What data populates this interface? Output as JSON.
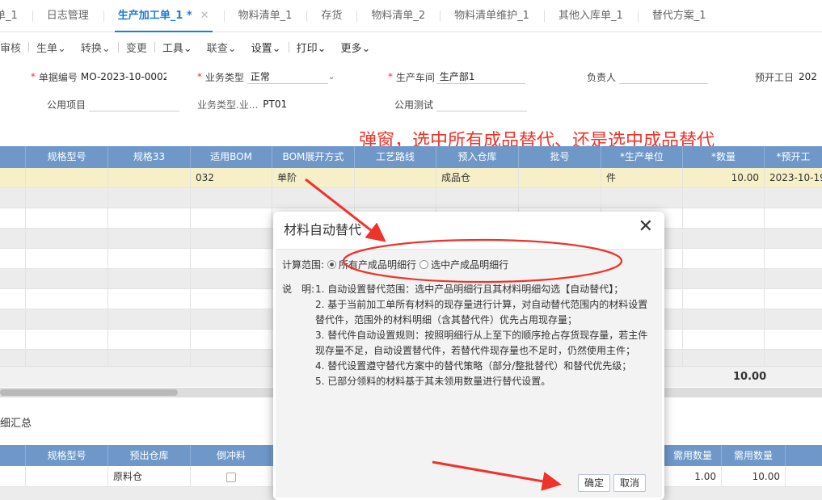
{
  "tabs": [
    {
      "label": "单_1"
    },
    {
      "label": "日志管理"
    },
    {
      "label": "生产加工单_1 *",
      "active": true
    },
    {
      "label": "物料清单_1"
    },
    {
      "label": "存货"
    },
    {
      "label": "物料清单_2"
    },
    {
      "label": "物料清单维护_1"
    },
    {
      "label": "其他入库单_1"
    },
    {
      "label": "替代方案_1"
    }
  ],
  "tab_close_glyph": "✕",
  "toolbar": {
    "items": [
      "审核",
      "生单⌄",
      "转换⌄",
      "变更",
      "工具⌄",
      "联查⌄",
      "设置⌄",
      "打印⌄",
      "更多⌄"
    ]
  },
  "form": {
    "doc_no_label": "单据编号",
    "doc_no": "MO-2023-10-0002",
    "biz_type_label": "业务类型",
    "biz_type": "正常",
    "workshop_label": "生产车间",
    "workshop": "生产部1",
    "owner_label": "负责人",
    "owner": "",
    "plan_date_label": "预开工日",
    "plan_date": "202",
    "common_item_label": "公用项目",
    "common_item": "",
    "biz_type_code_label": "业务类型.业...",
    "biz_type_code": "PT01",
    "common_test_label": "公用测试",
    "common_test": ""
  },
  "annotation": "弹窗，选中所有成品替代、还是选中成品替代",
  "grid": {
    "columns": [
      "规格型号",
      "规格33",
      "适用BOM",
      "BOM展开方式",
      "工艺路线",
      "预入仓库",
      "批号",
      "*生产单位",
      "*数量",
      "*预开工"
    ],
    "rows": [
      [
        "",
        "",
        "032",
        "单阶",
        "",
        "成品仓",
        "",
        "件",
        "10.00",
        "2023-10-19"
      ]
    ],
    "total": "10.00"
  },
  "section_title": "细汇总",
  "lower_grid": {
    "columns": [
      "规格型号",
      "预出仓库",
      "倒冲料",
      "需用数量",
      "需用数量"
    ],
    "row": {
      "warehouse": "原料仓",
      "qty1": "1.00",
      "qty2": "10.00"
    }
  },
  "dialog": {
    "title": "材料自动替代",
    "close": "✕",
    "scope_label": "计算范围:",
    "option_all": "所有产成品明细行",
    "option_selected": "选中产成品明细行",
    "desc_label": "说　明:",
    "desc": [
      "1. 自动设置替代范围：选中产品明细行且其材料明细勾选【自动替代】；",
      "2. 基于当前加工单所有材料的现存量进行计算，对自动替代范围内的材料设置替代件，范围外的材料明细（含其替代件）优先占用现存量；",
      "3. 替代件自动设置规则：按照明细行从上至下的顺序抢占存货现存量，若主件现存量不足，自动设置替代件，若替代件现存量也不足时，仍然使用主件；",
      "4. 替代设置遵守替代方案中的替代策略（部分/整批替代）和替代优先级；",
      "5. 已部分领料的材料基于其未领用数量进行替代设置。"
    ],
    "ok": "确定",
    "cancel": "取消"
  },
  "colors": {
    "accent": "#1e7bd6",
    "grid_header": "#6f98c9",
    "highlight_row": "#f7efc8",
    "annotation_red": "#f0322a"
  }
}
